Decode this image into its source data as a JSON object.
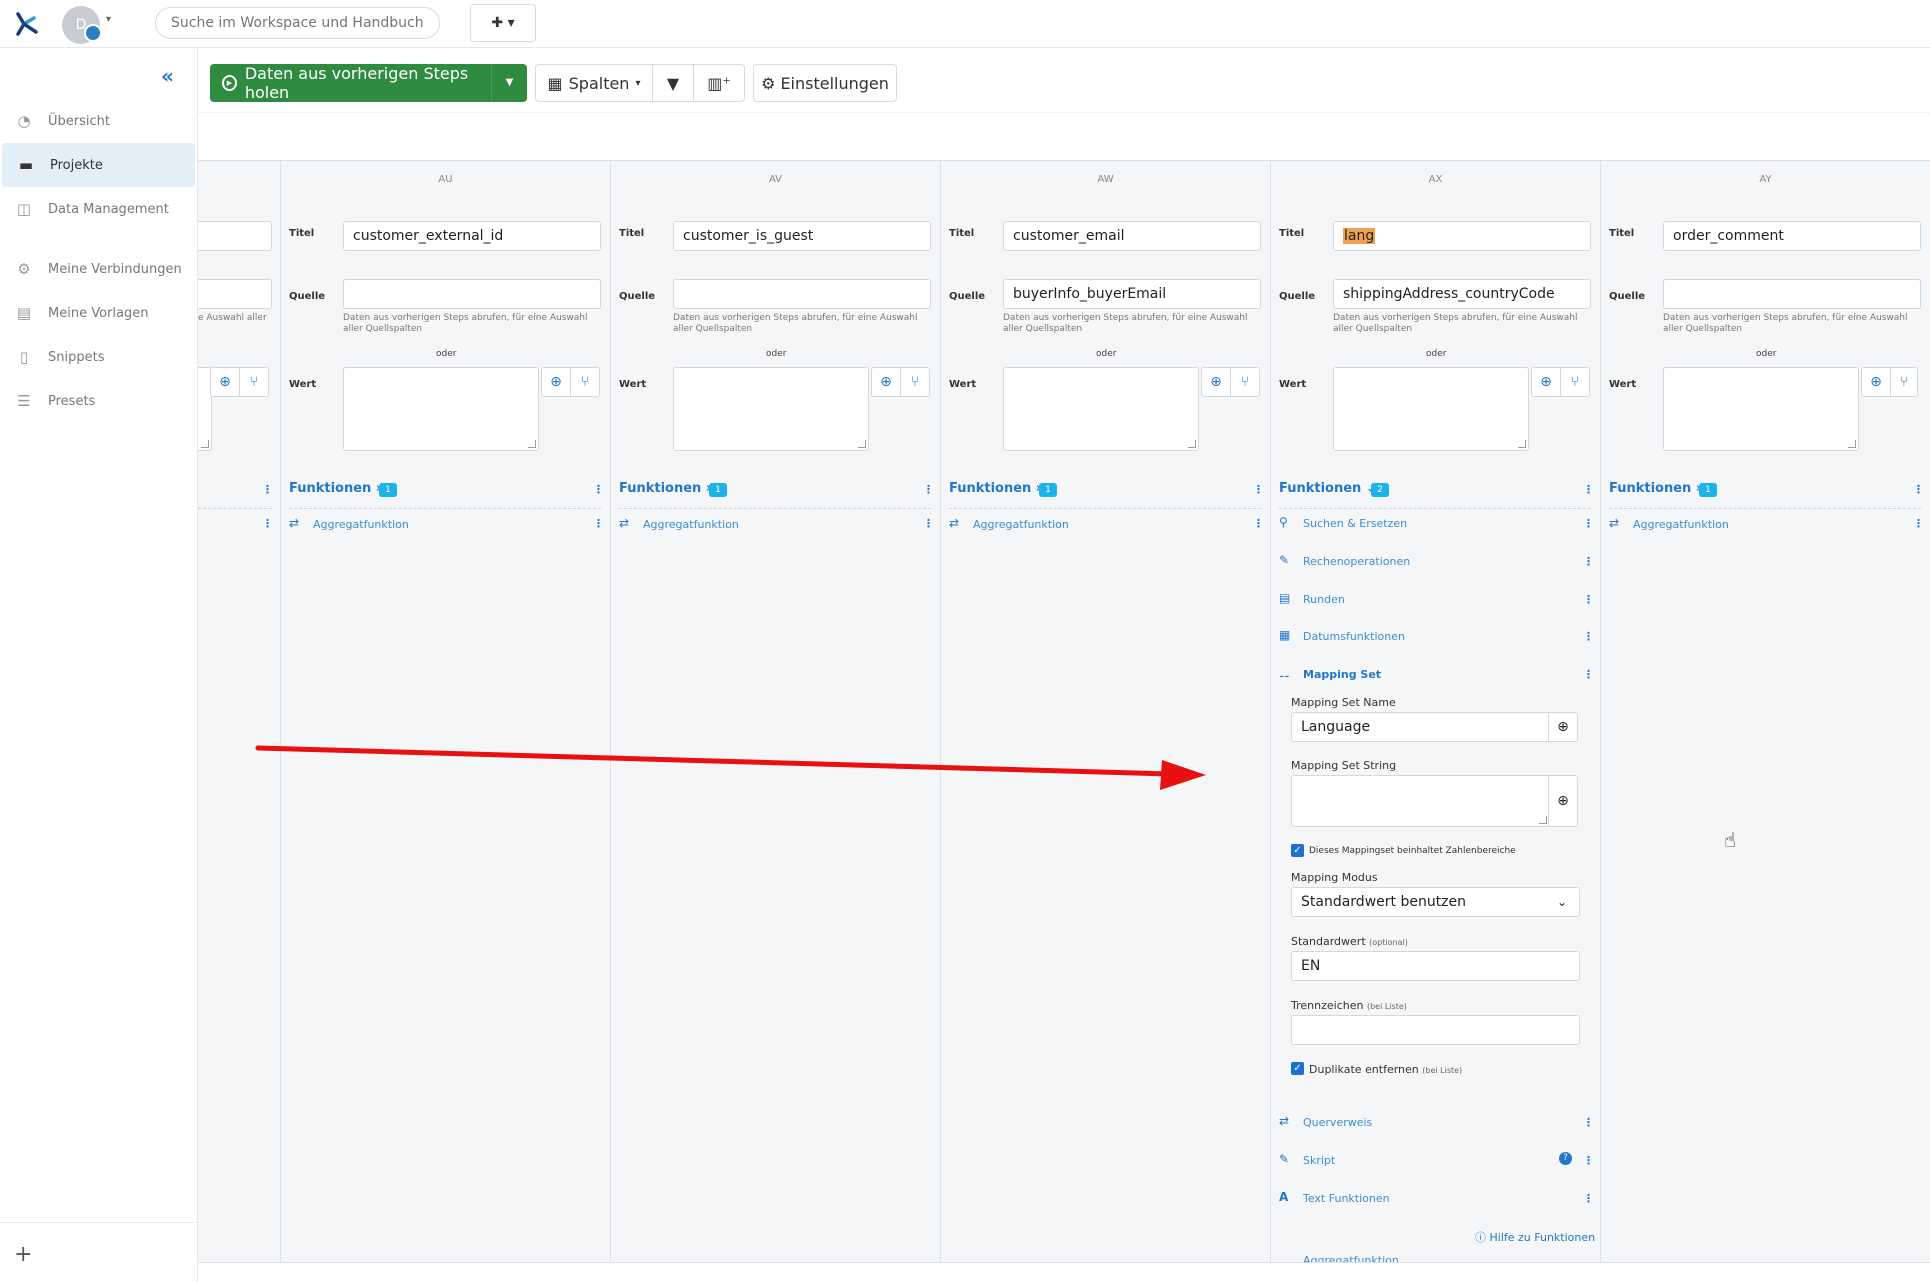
{
  "topbar": {
    "avatar_initial": "D",
    "search_placeholder": "Suche im Workspace und Handbuch",
    "add_button": "✚ ▾"
  },
  "sidebar": {
    "items": [
      {
        "label": "Übersicht",
        "icon": "dashboard-icon",
        "glyph": "◔"
      },
      {
        "label": "Projekte",
        "icon": "folder-open-icon",
        "glyph": "▬"
      },
      {
        "label": "Data Management",
        "icon": "database-icon",
        "glyph": "◫"
      },
      {
        "label": "Meine Verbindungen",
        "icon": "cogs-icon",
        "glyph": "⚙"
      },
      {
        "label": "Meine Vorlagen",
        "icon": "template-icon",
        "glyph": "▤"
      },
      {
        "label": "Snippets",
        "icon": "file-code-icon",
        "glyph": "▯"
      },
      {
        "label": "Presets",
        "icon": "sliders-icon",
        "glyph": "☰"
      }
    ],
    "active_index": 1
  },
  "toolbar": {
    "fetch_label": "Daten aus vorherigen Steps holen",
    "columns_label": "Spalten",
    "settings_label": "Einstellungen"
  },
  "labels": {
    "titel": "Titel",
    "quelle": "Quelle",
    "wert": "Wert",
    "oder": "oder",
    "hint": "Daten aus vorherigen Steps abrufen, für eine Auswahl aller Quellspalten",
    "hint_cut": "e Auswahl aller",
    "funktionen": "Funktionen",
    "aggregat": "Aggregatfunktion"
  },
  "columns": [
    {
      "letter": "AU",
      "title": "customer_external_id",
      "source": "",
      "fn_count": "1"
    },
    {
      "letter": "AV",
      "title": "customer_is_guest",
      "source": "",
      "fn_count": "1"
    },
    {
      "letter": "AW",
      "title": "customer_email",
      "source": "buyerInfo_buyerEmail",
      "fn_count": "1"
    },
    {
      "letter": "AX",
      "title": "lang",
      "source": "shippingAddress_countryCode",
      "fn_count": "2"
    },
    {
      "letter": "AY",
      "title": "order_comment",
      "source": "",
      "fn_count": "1"
    }
  ],
  "functions_list": [
    {
      "label": "Suchen & Ersetzen",
      "icon": "search-icon"
    },
    {
      "label": "Rechenoperationen",
      "icon": "magic-icon"
    },
    {
      "label": "Runden",
      "icon": "calculator-icon"
    },
    {
      "label": "Datumsfunktionen",
      "icon": "calendar-icon"
    },
    {
      "label": "Mapping Set",
      "icon": "sitemap-icon"
    }
  ],
  "mapping": {
    "name_label": "Mapping Set Name",
    "name_value": "Language",
    "string_label": "Mapping Set String",
    "ranges_label": "Dieses Mappingset beinhaltet Zahlenbereiche",
    "mode_label": "Mapping Modus",
    "mode_value": "Standardwert benutzen",
    "default_label": "Standardwert",
    "default_hint": "(optional)",
    "default_value": "EN",
    "sep_label": "Trennzeichen",
    "sep_hint": "(bei Liste)",
    "dedupe_label": "Duplikate entfernen",
    "dedupe_hint": "(bei Liste)"
  },
  "functions_list_2": [
    {
      "label": "Querverweis",
      "icon": "exchange-icon"
    },
    {
      "label": "Skript",
      "icon": "edit-icon"
    },
    {
      "label": "Text Funktionen",
      "icon": "font-icon"
    }
  ],
  "help_link": "Hilfe zu Funktionen",
  "cut_item": "Aggregatfunktion",
  "colors": {
    "accent": "#2277c9",
    "primary_button": "#2e8b3f",
    "badge": "#1bb3e8",
    "highlight": "#f0a050",
    "arrow": "#e81010"
  }
}
